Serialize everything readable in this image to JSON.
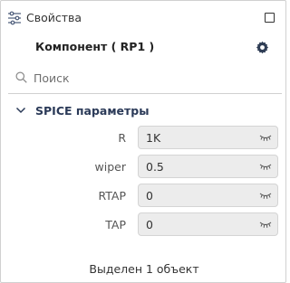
{
  "header": {
    "title": "Свойства",
    "icon": "sliders-icon",
    "window_icon": "window-icon"
  },
  "component": {
    "title": "Компонент ( RP1 )",
    "settings_icon": "gear-icon",
    "settings_icon_color": "#2f3d55"
  },
  "search": {
    "placeholder": "Поиск",
    "value": ""
  },
  "section": {
    "title": "SPICE параметры",
    "expanded": true,
    "params": [
      {
        "label": "R",
        "value": "1K"
      },
      {
        "label": "wiper",
        "value": "0.5"
      },
      {
        "label": "RTAP",
        "value": "0"
      },
      {
        "label": "TAP",
        "value": "0"
      }
    ]
  },
  "status": {
    "text": "Выделен 1 объект"
  },
  "colors": {
    "field_bg": "#ececec",
    "section_title": "#2b3a58",
    "border": "#d0d0d0"
  }
}
